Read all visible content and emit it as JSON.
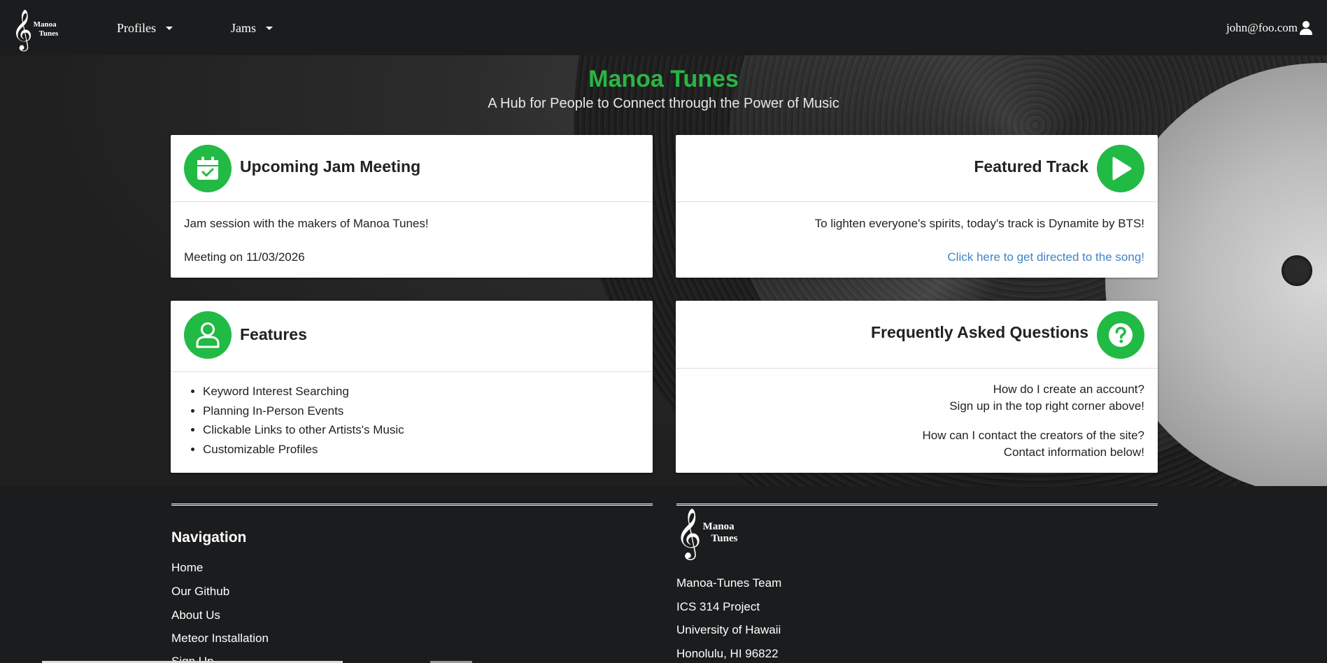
{
  "nav": {
    "logo_line1": "Manoa",
    "logo_line2": "Tunes",
    "profiles": "Profiles",
    "jams": "Jams",
    "user": "john@foo.com"
  },
  "hero": {
    "title": "Manoa Tunes",
    "subtitle": "A Hub for People to Connect through the Power of Music"
  },
  "cards": {
    "jam": {
      "title": "Upcoming Jam Meeting",
      "line1": "Jam session with the makers of Manoa Tunes!",
      "line2": "Meeting on 11/03/2026"
    },
    "track": {
      "title": "Featured Track",
      "line1": "To lighten everyone's spirits, today's track is Dynamite by BTS!",
      "link": "Click here to get directed to the song!"
    },
    "features": {
      "title": "Features",
      "items": [
        "Keyword Interest Searching",
        "Planning In-Person Events",
        "Clickable Links to other Artists's Music",
        "Customizable Profiles"
      ]
    },
    "faq": {
      "title": "Frequently Asked Questions",
      "q1": "How do I create an account?",
      "a1": "Sign up in the top right corner above!",
      "q2": "How can I contact the creators of the site?",
      "a2": "Contact information below!"
    }
  },
  "footer": {
    "nav_heading": "Navigation",
    "links": [
      "Home",
      "Our Github",
      "About Us",
      "Meteor Installation",
      "Sign Up"
    ],
    "logo_line1": "Manoa",
    "logo_line2": "Tunes",
    "team": "Manoa-Tunes Team",
    "project": "ICS 314 Project",
    "university": "University of Hawaii",
    "city": "Honolulu, HI 96822"
  },
  "colors": {
    "accent_green": "#21ba45",
    "title_green": "#2bb543",
    "link_blue": "#4183c4",
    "background": "#1b1c1d"
  }
}
